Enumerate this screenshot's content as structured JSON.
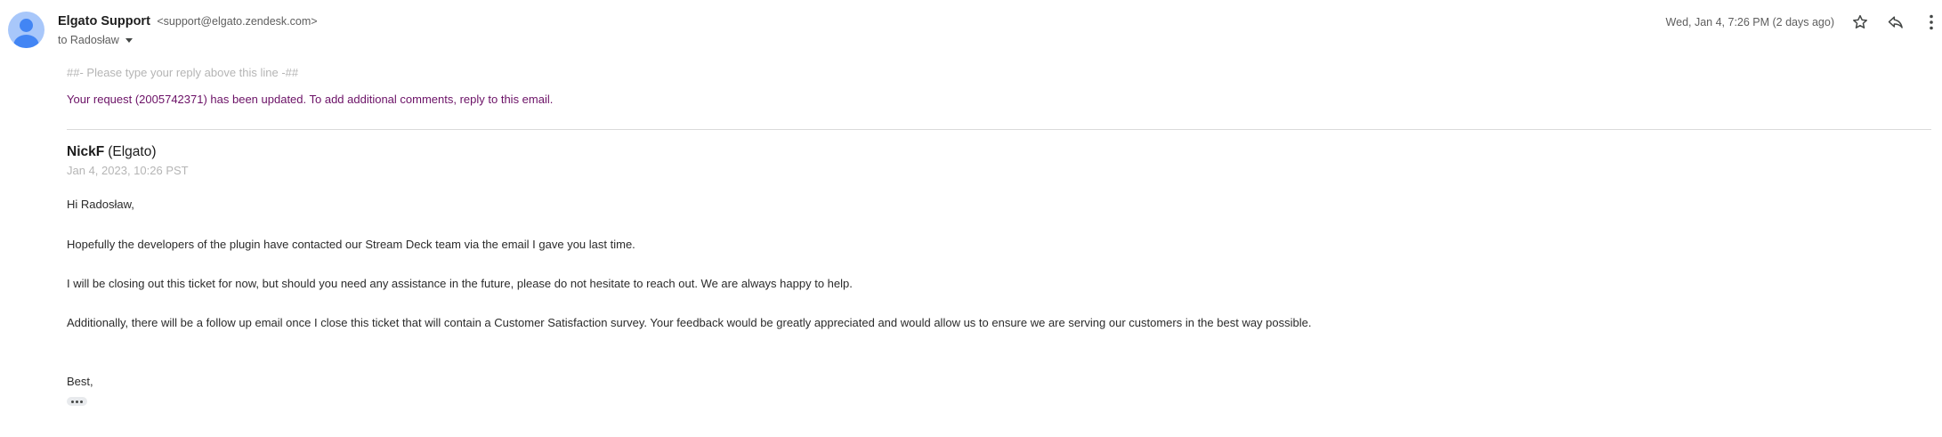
{
  "header": {
    "sender_name": "Elgato Support",
    "sender_email": "<support@elgato.zendesk.com>",
    "to_label": "to Radosław",
    "date": "Wed, Jan 4, 7:26 PM (2 days ago)",
    "icons": [
      "person-avatar-icon",
      "star-icon",
      "reply-icon",
      "more-vert-icon"
    ]
  },
  "body": {
    "reply_line": "##- Please type your reply above this line -##",
    "request_update": "Your request (2005742371) has been updated. To add additional comments, reply to this email.",
    "author_name": "NickF",
    "author_org": "(Elgato)",
    "comment_date": "Jan 4, 2023, 10:26 PST",
    "greeting": "Hi Radosław,",
    "paragraphs": [
      "Hopefully the developers of the plugin have contacted our Stream Deck team via the email I gave you last time.",
      "I will be closing out this ticket for now, but should you need any assistance in the future, please do not hesitate to reach out. We are always happy to help.",
      "Additionally, there will be a follow up email once I close this ticket that will contain a Customer Satisfaction survey. Your feedback would be greatly appreciated and would allow us to ensure we are serving our customers in the best way possible."
    ],
    "signoff": "Best,"
  },
  "colors": {
    "request_link": "#6b1166",
    "muted": "#b5b5b5",
    "avatar_bg": "#a8c7fa",
    "avatar_fg": "#4285f4"
  }
}
